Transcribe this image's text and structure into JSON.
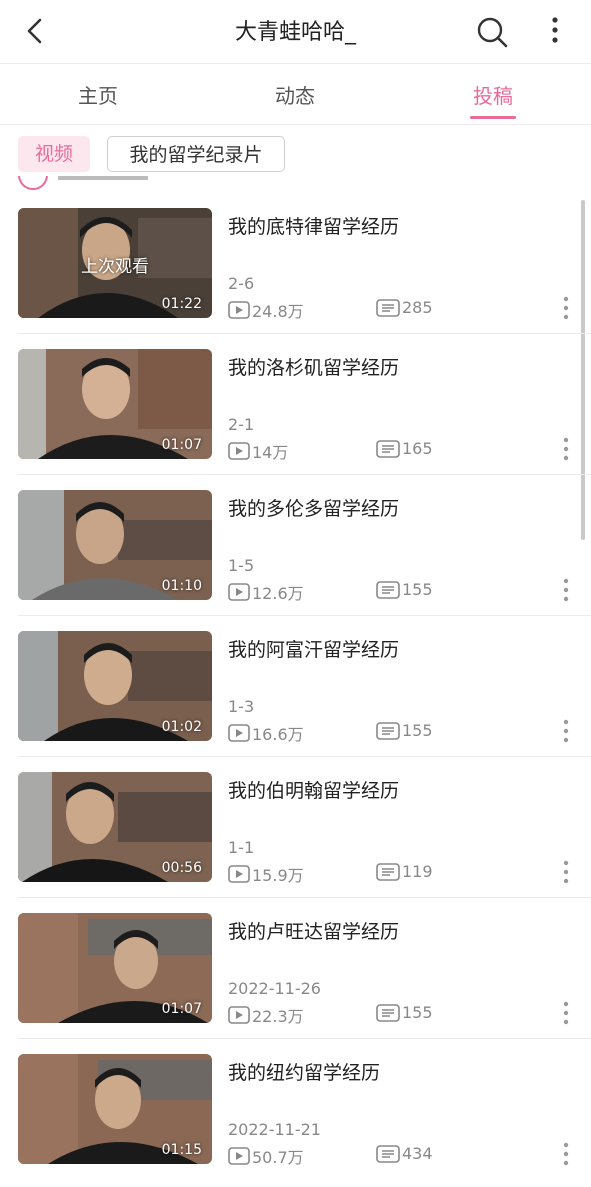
{
  "header": {
    "title": "大青蛙哈哈_"
  },
  "tabs": [
    {
      "label": "主页"
    },
    {
      "label": "动态"
    },
    {
      "label": "投稿"
    }
  ],
  "filters": {
    "active": "视频",
    "other": "我的留学纪录片"
  },
  "colors": {
    "accent": "#e86b9a",
    "text": "#222222",
    "muted": "#888888"
  },
  "videos": [
    {
      "title": "我的底特律留学经历",
      "date": "2-6",
      "views": "24.8万",
      "danmaku": "285",
      "duration": "01:22",
      "badge": "上次观看"
    },
    {
      "title": "我的洛杉矶留学经历",
      "date": "2-1",
      "views": "14万",
      "danmaku": "165",
      "duration": "01:07"
    },
    {
      "title": "我的多伦多留学经历",
      "date": "1-5",
      "views": "12.6万",
      "danmaku": "155",
      "duration": "01:10"
    },
    {
      "title": "我的阿富汗留学经历",
      "date": "1-3",
      "views": "16.6万",
      "danmaku": "155",
      "duration": "01:02"
    },
    {
      "title": "我的伯明翰留学经历",
      "date": "1-1",
      "views": "15.9万",
      "danmaku": "119",
      "duration": "00:56"
    },
    {
      "title": "我的卢旺达留学经历",
      "date": "2022-11-26",
      "views": "22.3万",
      "danmaku": "155",
      "duration": "01:07"
    },
    {
      "title": "我的纽约留学经历",
      "date": "2022-11-21",
      "views": "50.7万",
      "danmaku": "434",
      "duration": "01:15"
    }
  ]
}
